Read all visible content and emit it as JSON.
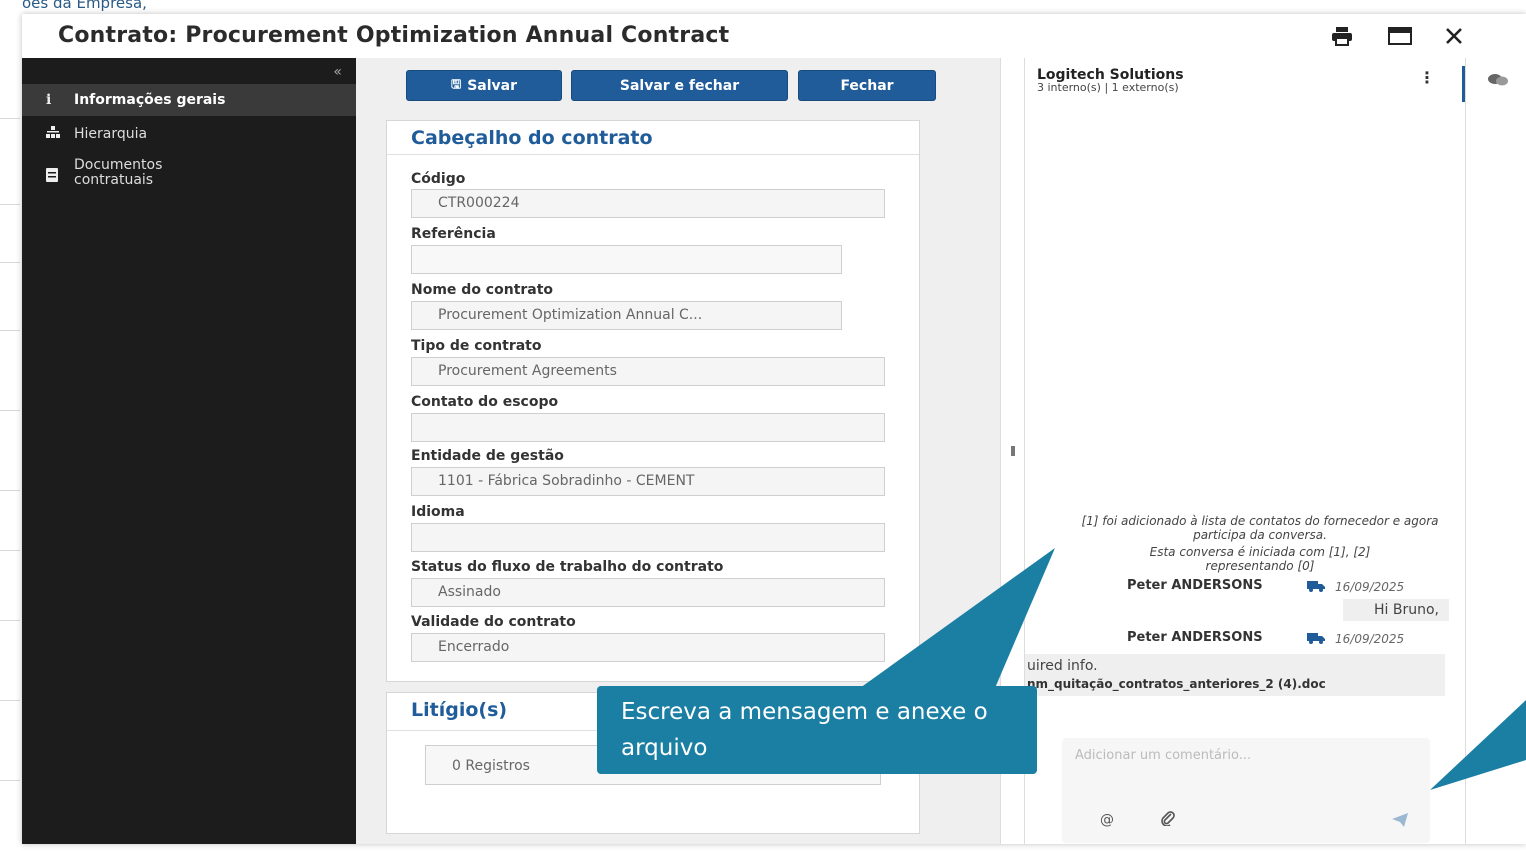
{
  "background": {
    "top_text": "oes da Empresa,"
  },
  "modal": {
    "title": "Contrato: Procurement Optimization Annual Contract",
    "icons": [
      "print-icon",
      "maximize-icon",
      "close-icon"
    ]
  },
  "sidebar": {
    "items": [
      {
        "icon": "info-icon",
        "label": "Informações gerais",
        "active": true
      },
      {
        "icon": "hierarchy-icon",
        "label": "Hierarquia",
        "active": false
      },
      {
        "icon": "documents-icon",
        "label": "Documentos contratuais",
        "active": false
      }
    ]
  },
  "toolbar": {
    "save_label": "Salvar",
    "save_close_label": "Salvar e fechar",
    "close_label": "Fechar"
  },
  "header_card": {
    "title": "Cabeçalho do contrato",
    "fields": [
      {
        "label": "Código",
        "value": ""
      },
      {
        "label": "Referência",
        "value": ""
      },
      {
        "label": "Nome do contrato",
        "value": ""
      },
      {
        "label": "Tipo de contrato",
        "value": ""
      },
      {
        "label": "Contato do escopo",
        "value": ""
      },
      {
        "label": "Entidade de gestão",
        "value": ""
      },
      {
        "label": "Idioma",
        "value": ""
      },
      {
        "label": "Status do fluxo de trabalho do contrato",
        "value": ""
      },
      {
        "label": "Validade do contrato",
        "value": ""
      }
    ],
    "values": {
      "codigo": "CTR000224",
      "referencia": "",
      "nome": "Procurement Optimization Annual C...",
      "tipo": "Procurement Agreements",
      "contato": "",
      "entidade": "1101 - Fábrica Sobradinho - CEMENT",
      "idioma": "",
      "status": "Assinado",
      "validade": "Encerrado"
    }
  },
  "litigio_card": {
    "title": "Litígio(s)",
    "records": "0 Registros"
  },
  "chat": {
    "company": "Logitech Solutions",
    "participants": "3 interno(s) | 1 externo(s)",
    "system_msg_1": "[1] foi adicionado à lista de contatos do fornecedor e agora participa da conversa.",
    "system_msg_2": "Esta conversa é iniciada com [1], [2] representando [0]",
    "messages": [
      {
        "sender": "Peter ANDERSONS",
        "date": "16/09/2025",
        "text": "Hi Bruno,"
      },
      {
        "sender": "Peter ANDERSONS",
        "date": "16/09/2025",
        "text": "uired info."
      }
    ],
    "attachment": "nm_quitação_contratos_anteriores_2 (4).doc",
    "composer_placeholder": "Adicionar um comentário..."
  },
  "callout": {
    "text": "Escreva a mensagem e anexe o arquivo"
  },
  "colors": {
    "primary": "#1f5c99",
    "callout": "#1a7fa3",
    "sidebar_bg": "#1c1c1c"
  }
}
